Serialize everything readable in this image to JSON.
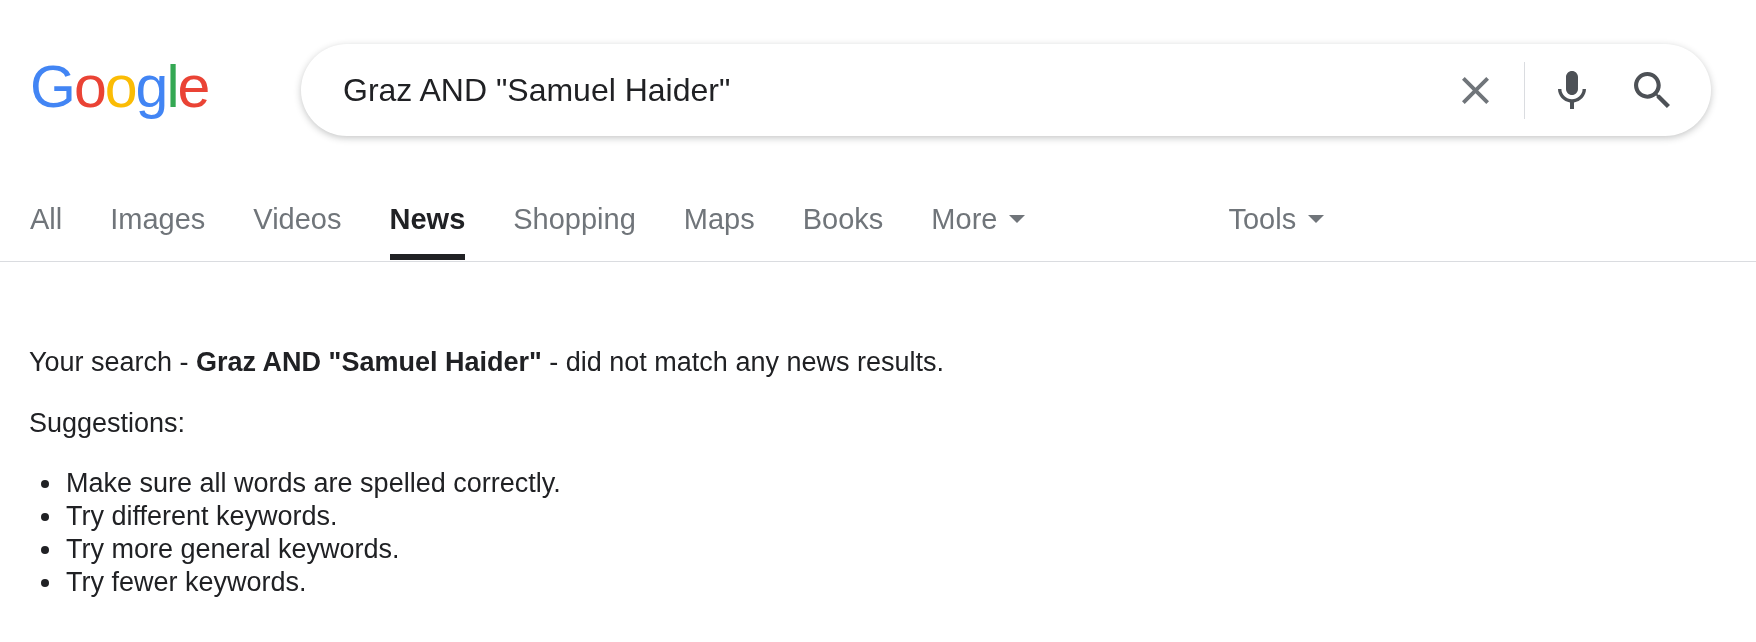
{
  "logo": {
    "text": "Google"
  },
  "search": {
    "value": "Graz AND \"Samuel Haider\""
  },
  "tabs": [
    {
      "label": "All",
      "selected": false
    },
    {
      "label": "Images",
      "selected": false
    },
    {
      "label": "Videos",
      "selected": false
    },
    {
      "label": "News",
      "selected": true
    },
    {
      "label": "Shopping",
      "selected": false
    },
    {
      "label": "Maps",
      "selected": false
    },
    {
      "label": "Books",
      "selected": false
    }
  ],
  "more_menu": {
    "label": "More"
  },
  "tools": {
    "label": "Tools"
  },
  "results": {
    "message": "Your search - **Graz AND \"Samuel Haider\"** - did not match any news results.",
    "suggestions_heading": "Suggestions:",
    "suggestions": [
      "Make sure all words are spelled correctly.",
      "Try different keywords.",
      "Try more general keywords.",
      "Try fewer keywords."
    ]
  }
}
